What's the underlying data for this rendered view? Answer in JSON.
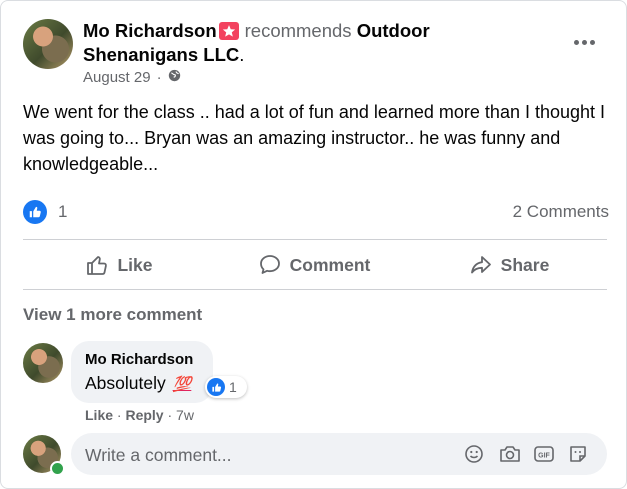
{
  "post": {
    "author": "Mo Richardson",
    "recommends_text": "recommends",
    "page_name": "Outdoor Shenanigans LLC",
    "page_suffix": ".",
    "date": "August 29",
    "date_separator": "·",
    "body": "We went for the class .. had a lot of fun and learned more than I thought I was going to... Bryan was an amazing instructor.. he was funny and knowledgeable...",
    "reaction_count": "1",
    "comments_count": "2 Comments"
  },
  "actions": {
    "like": "Like",
    "comment": "Comment",
    "share": "Share"
  },
  "comments": {
    "view_more": "View 1 more comment",
    "items": [
      {
        "author": "Mo Richardson",
        "text": "Absolutely",
        "emoji": "💯",
        "reaction_count": "1",
        "like_label": "Like",
        "reply_label": "Reply",
        "separator": "·",
        "age": "7w"
      }
    ]
  },
  "composer": {
    "placeholder": "Write a comment...",
    "icons": [
      "emoji-icon",
      "camera-icon",
      "gif-icon",
      "sticker-icon"
    ]
  },
  "colors": {
    "accent": "#1877f2",
    "muted": "#65676b",
    "recommend_badge": "#f3425f",
    "online": "#31a24c",
    "bubble": "#f0f2f5"
  }
}
